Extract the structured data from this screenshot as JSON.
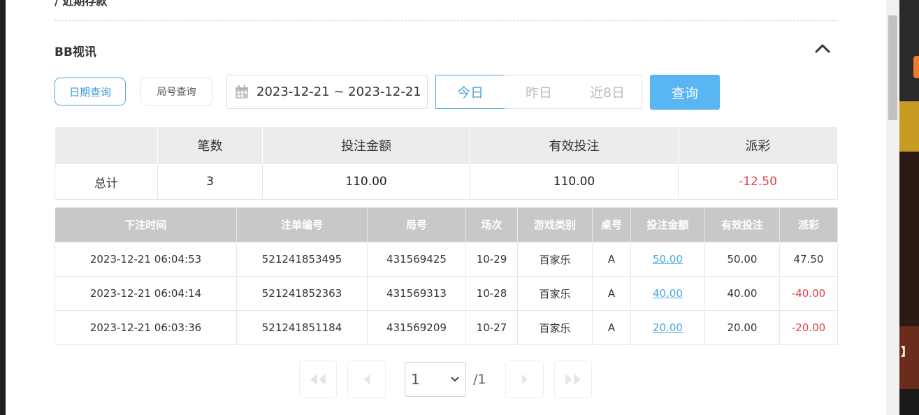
{
  "header": {
    "partial_title": "/ 近期存款",
    "section_title": "BB视讯"
  },
  "filters": {
    "date_query_label": "日期查询",
    "round_query_label": "局号查询",
    "date_range": "2023-12-21 ~ 2023-12-21",
    "today_label": "今日",
    "yesterday_label": "昨日",
    "last8_label": "近8日",
    "query_label": "查询"
  },
  "summary": {
    "headers": [
      "",
      "笔数",
      "投注金额",
      "有效投注",
      "派彩"
    ],
    "row": {
      "label": "总计",
      "count": "3",
      "bet_amount": "110.00",
      "valid_bet": "110.00",
      "payout": "-12.50"
    }
  },
  "detail": {
    "headers": [
      "下注时间",
      "注单编号",
      "局号",
      "场次",
      "游戏类别",
      "桌号",
      "投注金额",
      "有效投注",
      "派彩"
    ],
    "rows": [
      {
        "time": "2023-12-21 06:04:53",
        "order": "521241853495",
        "round": "431569425",
        "session": "10-29",
        "game": "百家乐",
        "table": "A",
        "bet": "50.00",
        "valid": "50.00",
        "payout": "47.50",
        "negative": false
      },
      {
        "time": "2023-12-21 06:04:14",
        "order": "521241852363",
        "round": "431569313",
        "session": "10-28",
        "game": "百家乐",
        "table": "A",
        "bet": "40.00",
        "valid": "40.00",
        "payout": "-40.00",
        "negative": true
      },
      {
        "time": "2023-12-21 06:03:36",
        "order": "521241851184",
        "round": "431569209",
        "session": "10-27",
        "game": "百家乐",
        "table": "A",
        "bet": "20.00",
        "valid": "20.00",
        "payout": "-20.00",
        "negative": true
      }
    ]
  },
  "pagination": {
    "current_page": "1",
    "total_pages": "/1"
  },
  "colors": {
    "accent": "#4aa8e0",
    "query_button": "#5ab6f2",
    "negative": "#e0434c"
  }
}
